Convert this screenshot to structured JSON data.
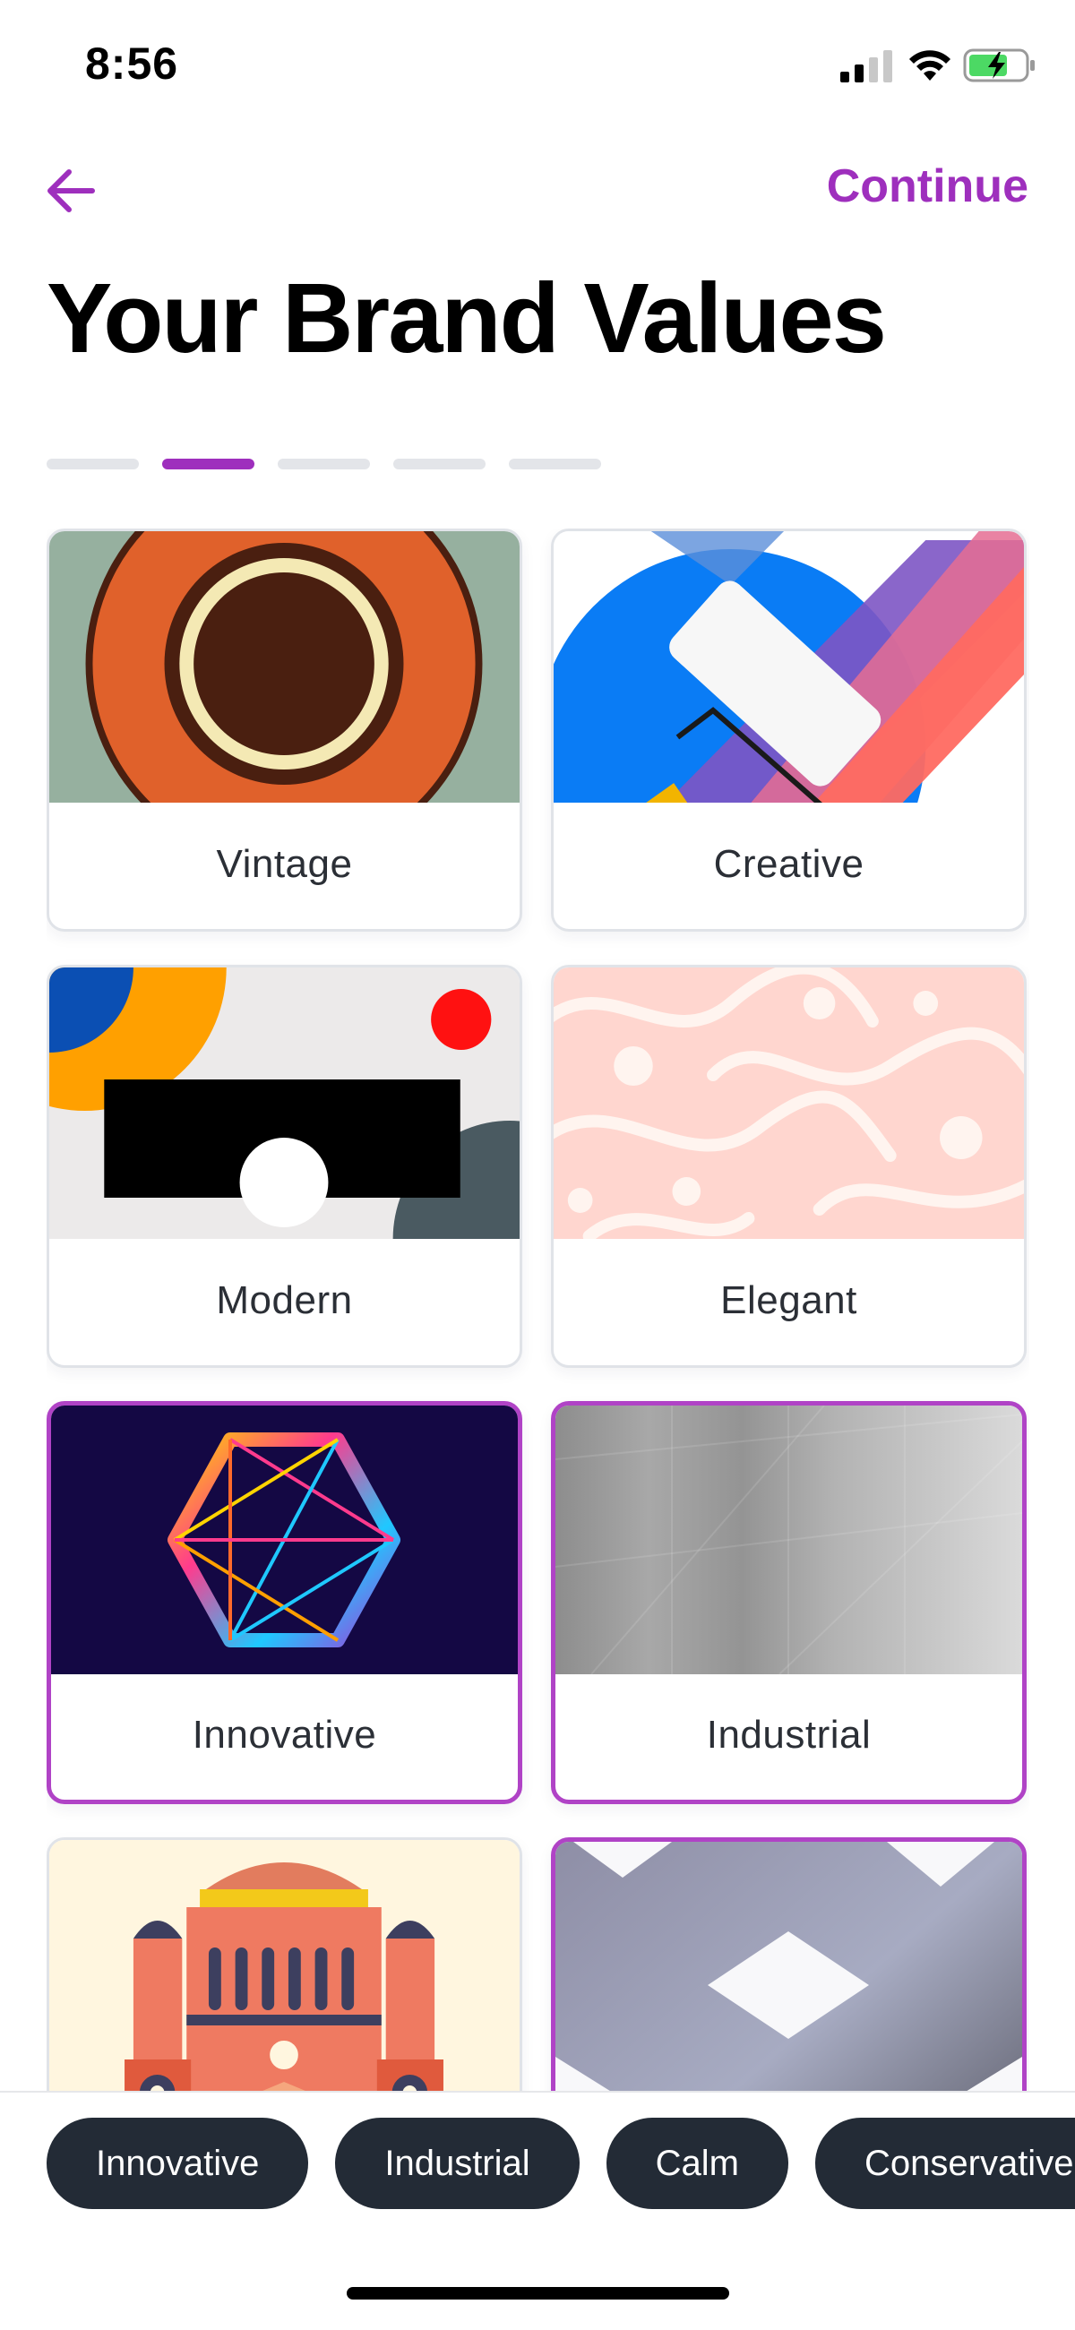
{
  "status_bar": {
    "time": "8:56"
  },
  "header": {
    "back_icon": "arrow-left-icon",
    "continue_label": "Continue",
    "accent_color": "#9e2fbd"
  },
  "title": "Your Brand Values",
  "progress": {
    "total_steps": 5,
    "current_step": 2
  },
  "cards": [
    {
      "label": "Vintage",
      "selected": false
    },
    {
      "label": "Creative",
      "selected": false
    },
    {
      "label": "Modern",
      "selected": false
    },
    {
      "label": "Elegant",
      "selected": false
    },
    {
      "label": "Innovative",
      "selected": true
    },
    {
      "label": "Industrial",
      "selected": true
    },
    {
      "label": "",
      "selected": false
    },
    {
      "label": "",
      "selected": true
    }
  ],
  "selected_chips": [
    "Innovative",
    "Industrial",
    "Calm",
    "Conservative"
  ]
}
